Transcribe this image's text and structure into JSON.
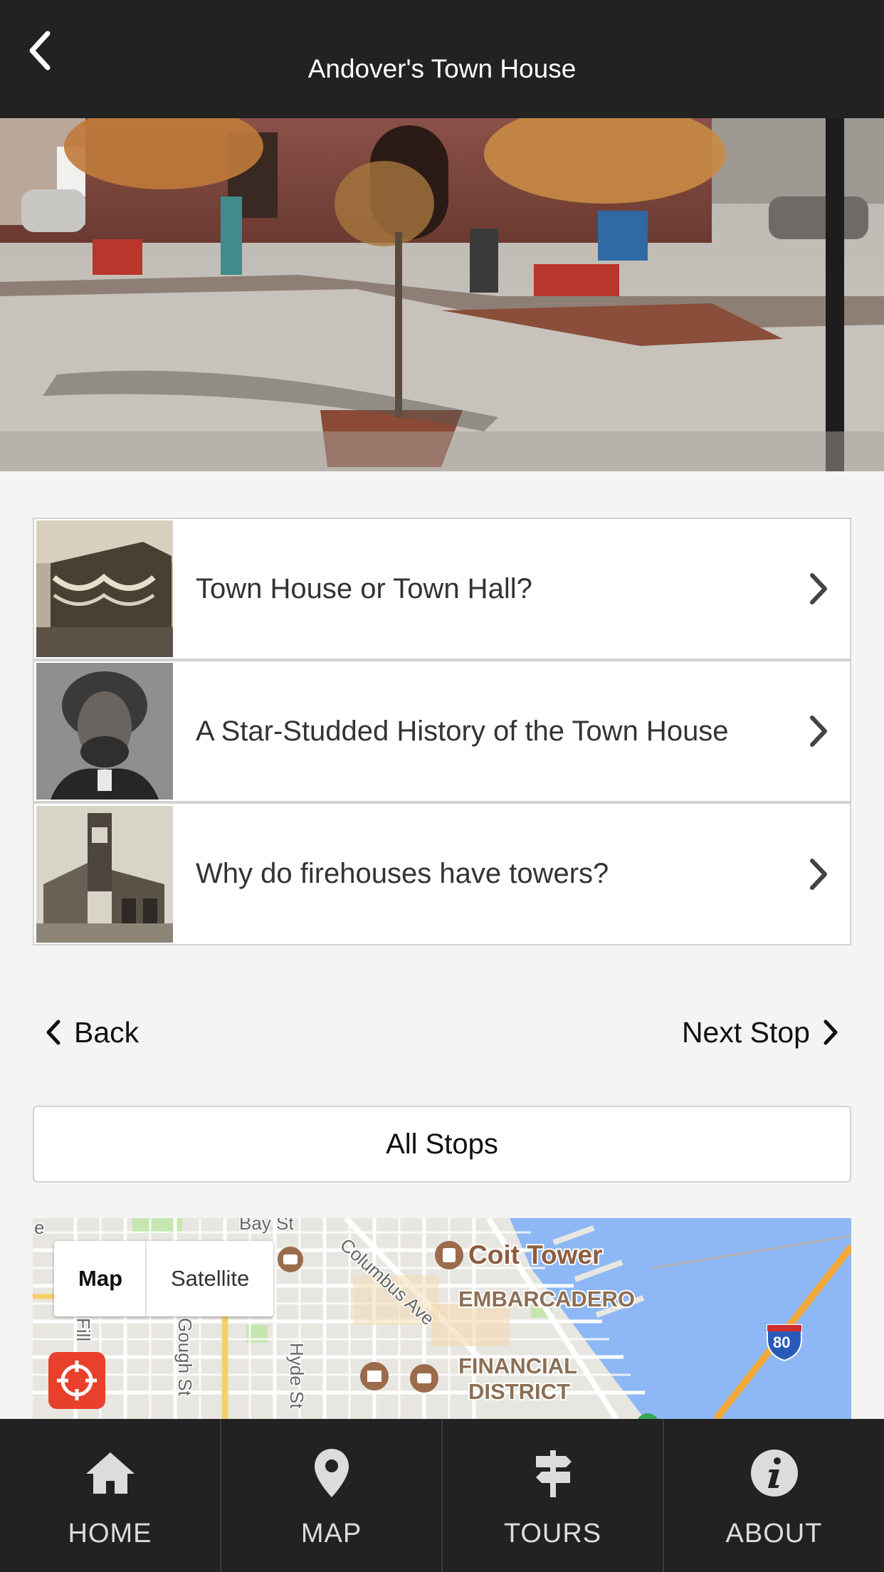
{
  "header": {
    "title": "Andover's Town House"
  },
  "hero": {
    "alt": "Street view of Andover's Town House"
  },
  "stories": [
    {
      "title": "Town House or Town Hall?",
      "thumb_icon": "town-hall-photo"
    },
    {
      "title": "A Star-Studded History of the Town House",
      "thumb_icon": "portrait-photo"
    },
    {
      "title": "Why do firehouses have towers?",
      "thumb_icon": "firehouse-photo"
    }
  ],
  "nav": {
    "back_label": "Back",
    "next_label": "Next Stop"
  },
  "all_stops_label": "All Stops",
  "map": {
    "toggle": {
      "map_label": "Map",
      "satellite_label": "Satellite",
      "selected": "Map"
    },
    "labels": {
      "coit_tower": "Coit Tower",
      "embarcadero": "EMBARCADERO",
      "financial_1": "FINANCIAL",
      "financial_2": "DISTRICT",
      "columbus": "Columbus Ave",
      "gough": "Gough St",
      "hyde": "Hyde St",
      "bay": "Bay St",
      "fillmore": "Fill",
      "edge_e": "e",
      "interstate": "80"
    },
    "colors": {
      "water": "#8db8f5",
      "land": "#e8e6e1",
      "highway": "#f7b547",
      "park": "#c6e6b0",
      "locate": "#e8402b"
    }
  },
  "tabs": [
    {
      "label": "HOME",
      "icon": "home-icon"
    },
    {
      "label": "MAP",
      "icon": "map-pin-icon"
    },
    {
      "label": "TOURS",
      "icon": "signpost-icon"
    },
    {
      "label": "ABOUT",
      "icon": "info-icon"
    }
  ]
}
